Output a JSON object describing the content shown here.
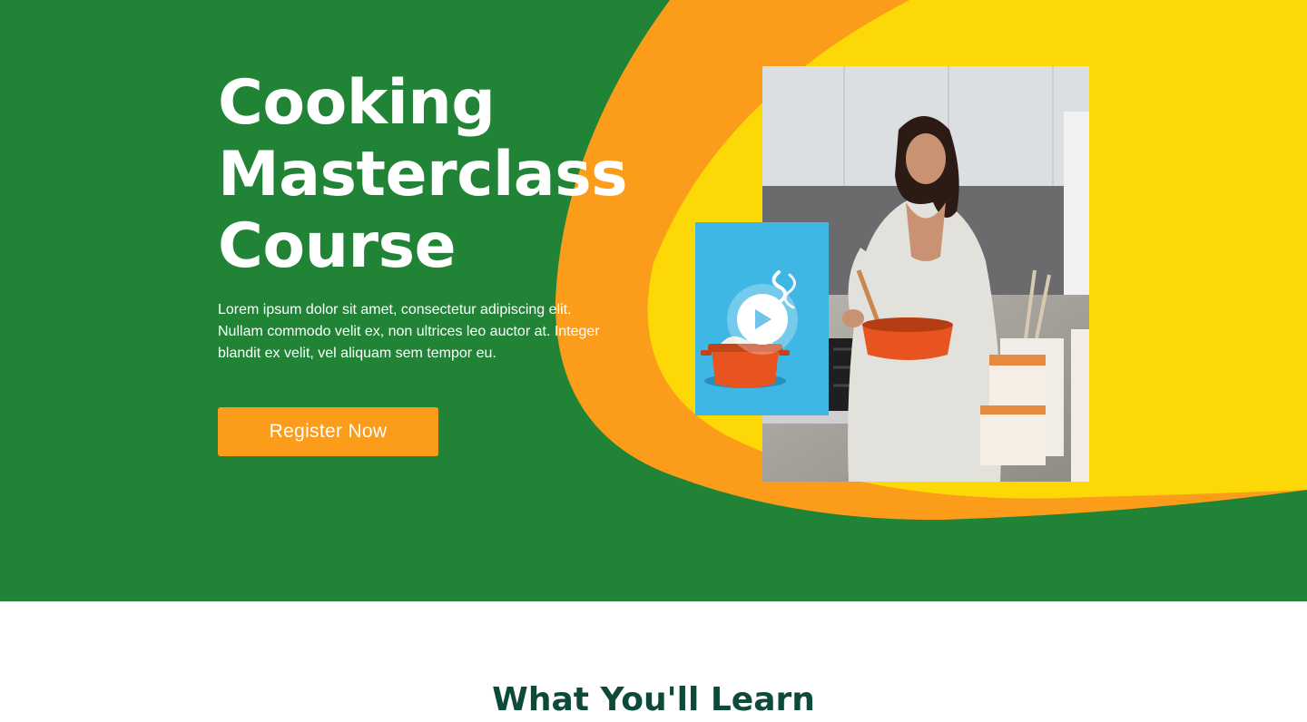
{
  "hero": {
    "title_lines": [
      "Cooking",
      "Masterclass",
      "Course"
    ],
    "description_lines": [
      "Lorem ipsum dolor sit amet, consectetur adipiscing elit.",
      "Nullam commodo velit ex, non ultrices leo auctor at. Integer",
      "blandit ex velit, vel aliquam sem tempor eu."
    ],
    "cta_label": "Register Now"
  },
  "media": {
    "main_image_icon": "woman-cooking-photo",
    "video_thumbnail_icon": "pot-with-noodles-thumbnail",
    "play_icon": "play-icon"
  },
  "section": {
    "title": "What You'll Learn"
  },
  "colors": {
    "hero_green": "#218336",
    "accent_orange": "#fb9c1a",
    "accent_yellow": "#fbd806",
    "heading_dark_green": "#0d4a3a",
    "thumbnail_blue": "#3fb7e4",
    "pot_orange": "#e8541f"
  }
}
